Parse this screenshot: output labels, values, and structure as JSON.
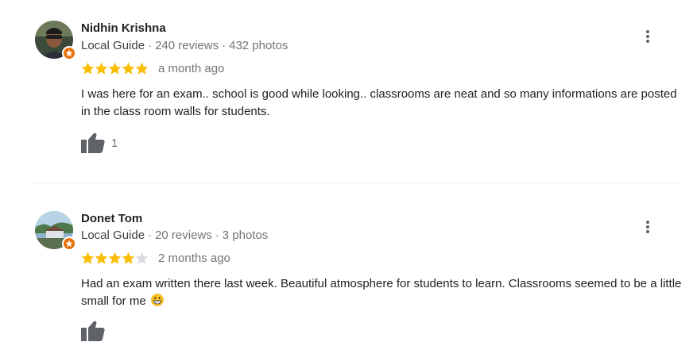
{
  "reviews": [
    {
      "name": "Nidhin Krishna",
      "guide_label": "Local Guide",
      "reviews_count": "240 reviews",
      "photos_count": "432 photos",
      "separator": "·",
      "rating": 5,
      "rating_max": 5,
      "date": "a month ago",
      "text": "I was here for an exam.. school is good while looking.. classrooms are neat and so many informations are posted in the class room walls for students.",
      "likes": "1"
    },
    {
      "name": "Donet Tom",
      "guide_label": "Local Guide",
      "reviews_count": "20 reviews",
      "photos_count": "3 photos",
      "separator": "·",
      "rating": 4,
      "rating_max": 5,
      "date": "2 months ago",
      "text": "Had an exam written there last week. Beautiful atmosphere for students to learn. Classrooms seemed to be a little small for me",
      "emoji": "grinning-face-icon"
    }
  ],
  "colors": {
    "star_filled": "#fbbc04",
    "star_empty": "#dadce0",
    "guide_badge": "#e8710a",
    "meta_text": "#70757a",
    "icon_gray": "#5f6368"
  }
}
